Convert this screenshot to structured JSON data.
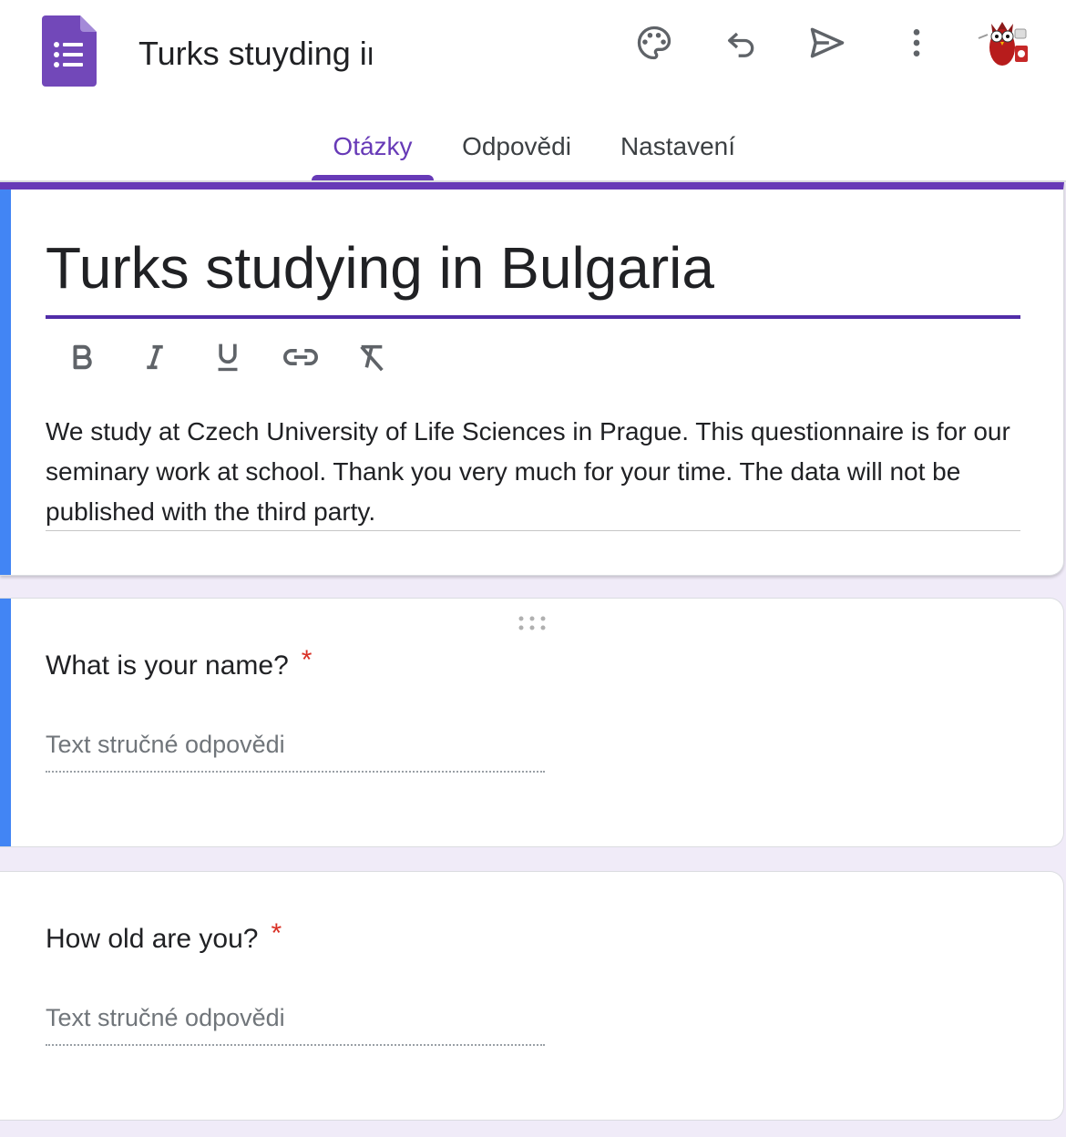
{
  "header": {
    "doc_title": "Turks stuyding in Bulgaria",
    "icons": [
      "forms-logo-icon",
      "palette-icon",
      "undo-icon",
      "send-icon",
      "more-vert-icon",
      "avatar"
    ]
  },
  "tabs": [
    {
      "label": "Otázky",
      "active": true
    },
    {
      "label": "Odpovědi",
      "active": false
    },
    {
      "label": "Nastavení",
      "active": false
    }
  ],
  "form": {
    "title": "Turks studying in Bulgaria",
    "description": "We study at Czech University of Life Sciences in Prague. This questionnaire is for our seminary work at school. Thank you very much for your time. The data will not be published with the third party.",
    "format_toolbar": [
      "bold-icon",
      "italic-icon",
      "underline-icon",
      "link-icon",
      "clear-format-icon"
    ]
  },
  "questions": [
    {
      "title": "What is your name?",
      "required_mark": "*",
      "placeholder": "Text stručné odpovědi"
    },
    {
      "title": "How old are you?",
      "required_mark": "*",
      "placeholder": "Text stručné odpovědi"
    }
  ],
  "colors": {
    "accent": "#673ab7",
    "active_question": "#4285f4",
    "background": "#f0ebf8",
    "required": "#d93025"
  }
}
